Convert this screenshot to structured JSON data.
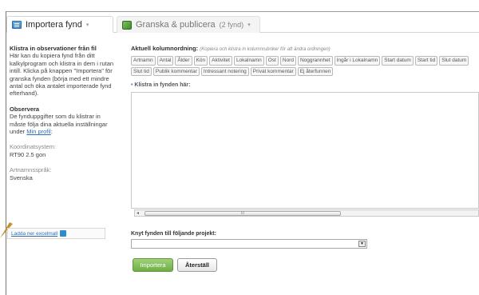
{
  "tabs": [
    {
      "label": "Importera fynd",
      "icon": "list-icon",
      "active": true
    },
    {
      "label": "Granska & publicera",
      "count": "(2 fynd)",
      "icon": "publish-icon",
      "active": false
    }
  ],
  "sidebar": {
    "heading": "Klistra in observationer från fil",
    "intro": "Här kan du kopiera fynd från ditt kalkylprogram och klistra in dem i rutan intill. Klicka på knappen \"Importera\" för granska fynden (börja med ett mindre antal och öka antalet importerade fynd efterhand).",
    "notice_heading": "Observera",
    "notice_text": "De fynduppgifter som du klistrar in måste följa dina aktuella inställningar under",
    "profile_link": "Min profil",
    "profile_suffix": ":",
    "coord_label": "Koordinatsystem:",
    "coord_value": "RT90 2.5 gon",
    "lang_label": "Artnamnsspråk:",
    "lang_value": "Svenska",
    "excel_link": "Ladda ner excelmall"
  },
  "main": {
    "colorder_title": "Aktuell kolumnordning:",
    "colorder_hint": "(Kopiera och klistra in kolumnrubriker för att ändra ordningen)",
    "columns": [
      "Artnamn",
      "Antal",
      "Ålder",
      "Kön",
      "Aktivitet",
      "Lokalnamn",
      "Ost",
      "Nord",
      "Noggrannhet",
      "Ingår i Lokalnamn",
      "Start datum",
      "Start tid",
      "Slut datum",
      "Slut tid",
      "Publik kommentar",
      "Intressant notering",
      "Privat kommentar",
      "Ej återfunnen"
    ],
    "paste_label": "Klistra in fynden här:",
    "scroll_thumb": "III",
    "project_label": "Knyt fynden till följande projekt:",
    "project_value": "",
    "import_button": "Importera",
    "reset_button": "Återställ"
  }
}
